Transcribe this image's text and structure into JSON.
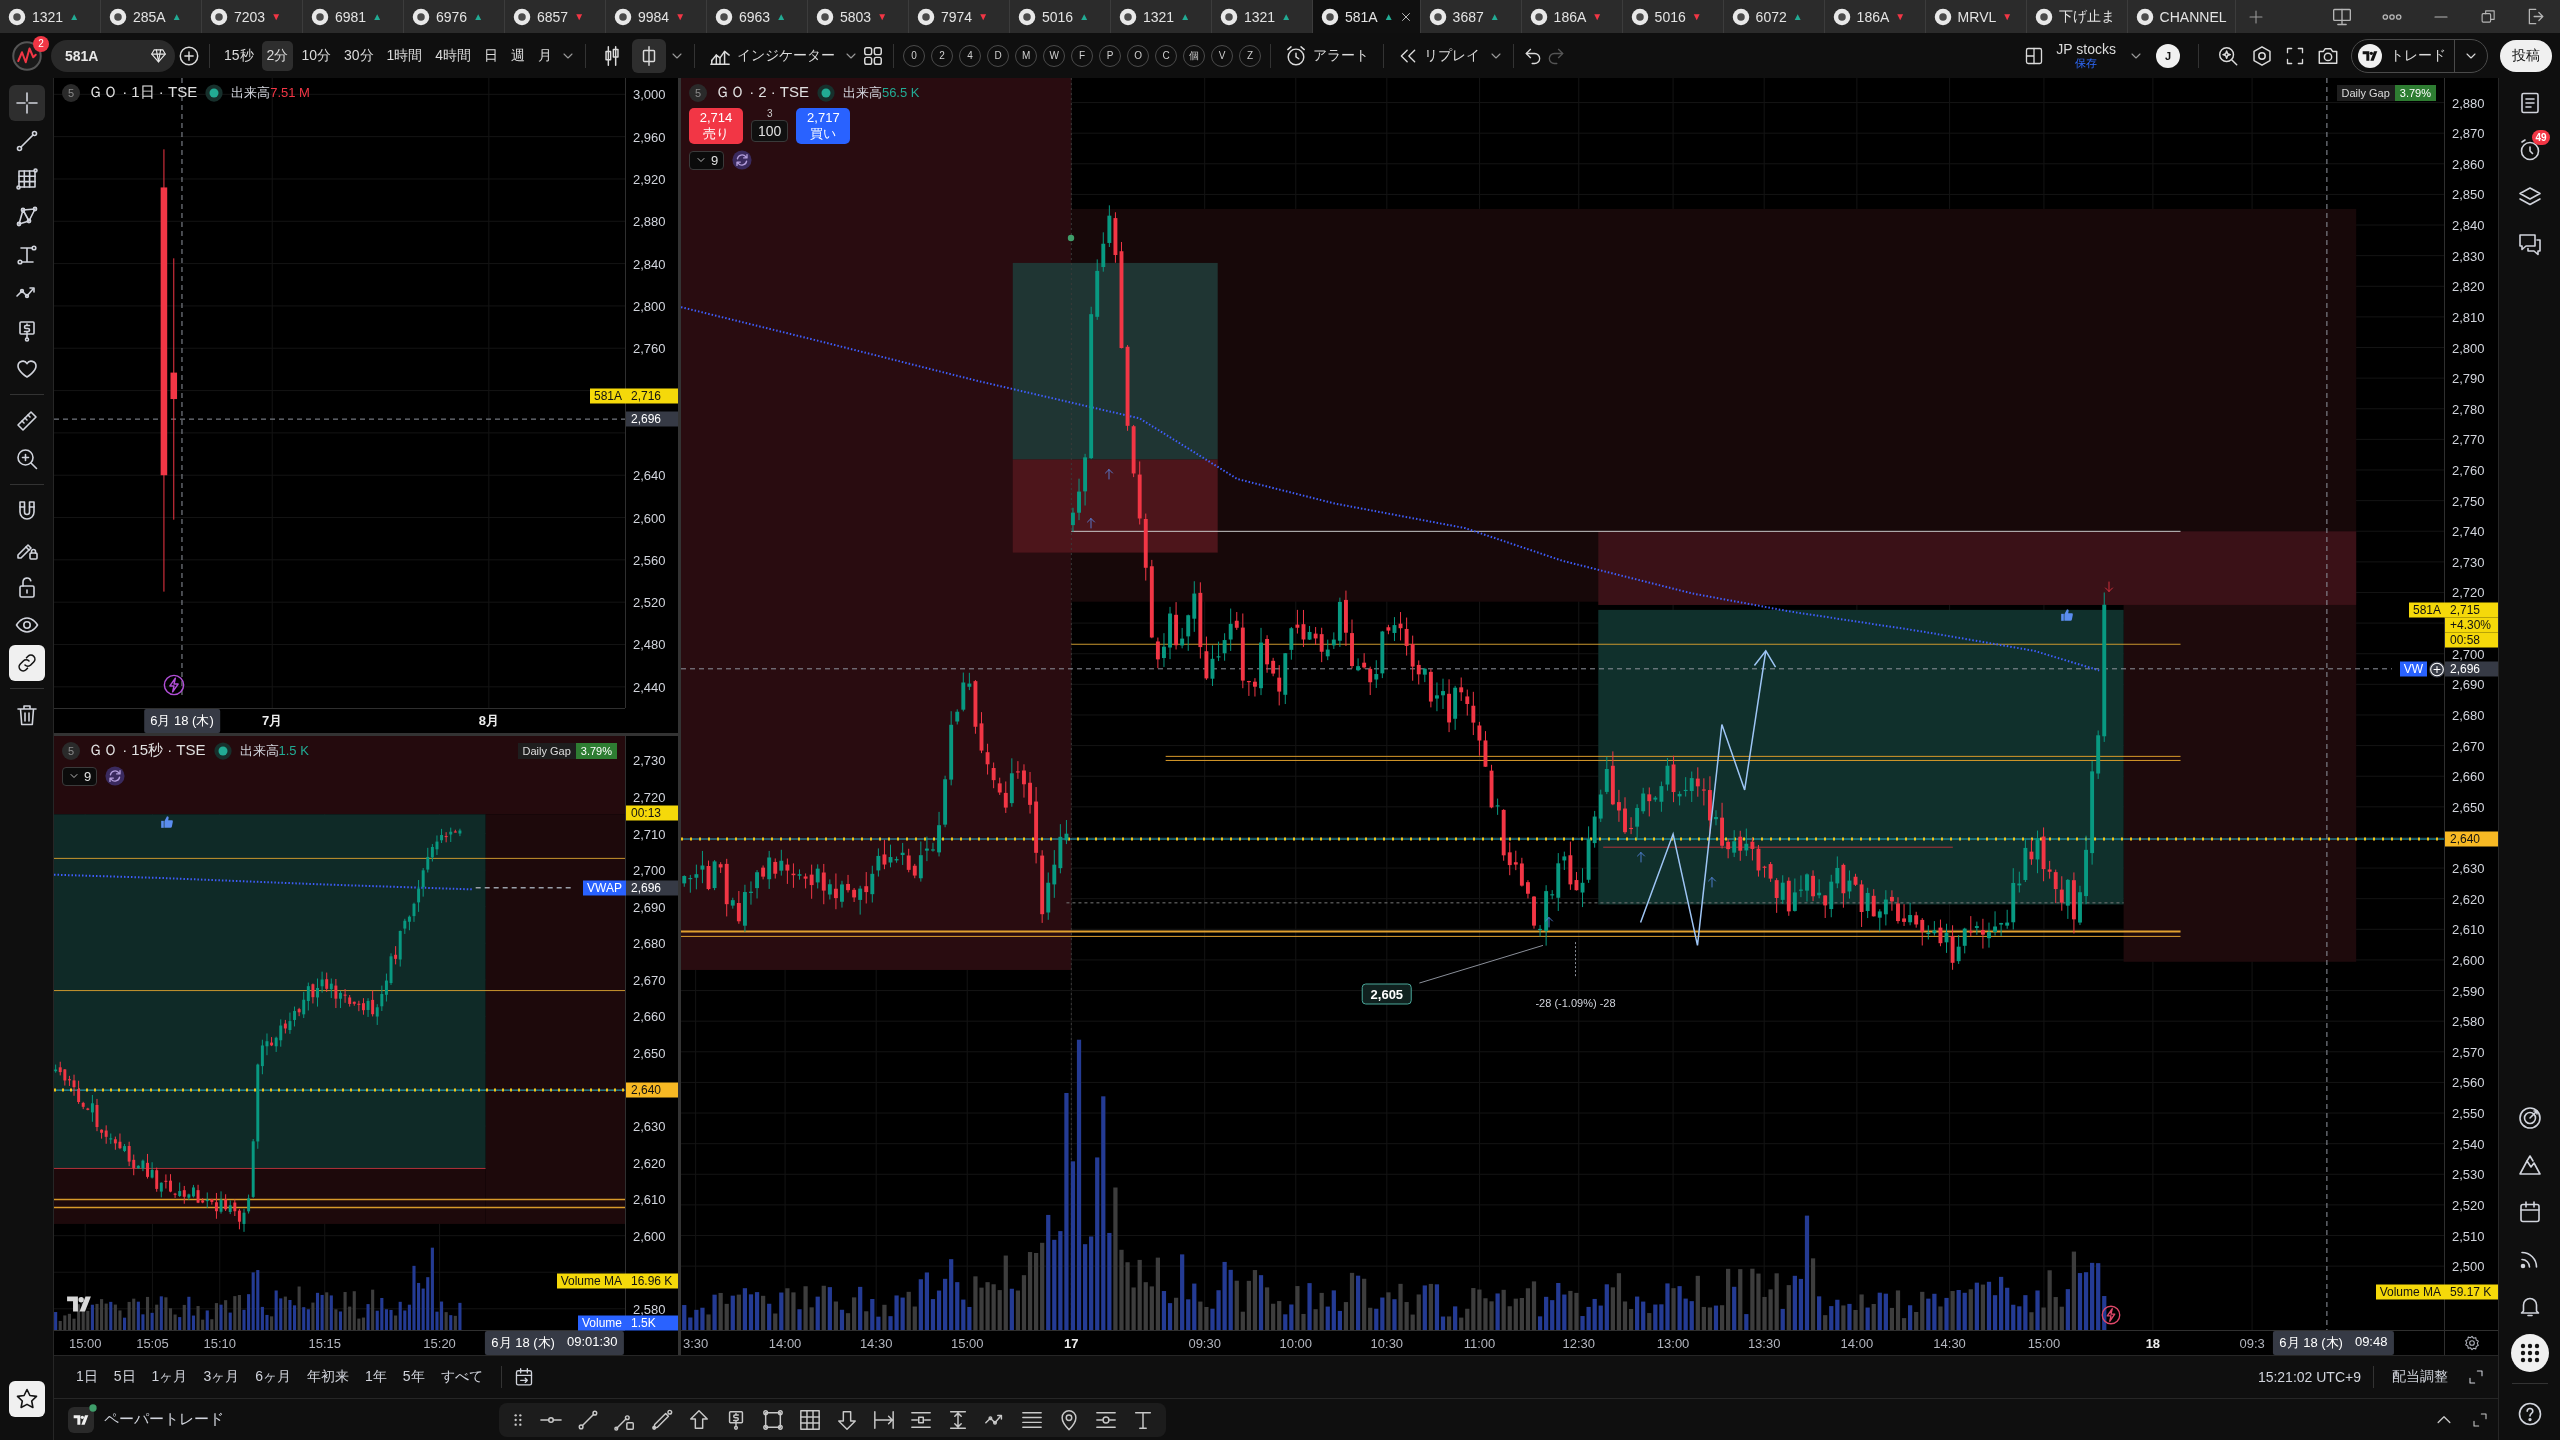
{
  "tabs": [
    {
      "symbol": "1321",
      "arrow": "▲",
      "color": "#22ab94",
      "selected": false
    },
    {
      "symbol": "285A",
      "arrow": "▲",
      "color": "#22ab94",
      "selected": false
    },
    {
      "symbol": "7203",
      "arrow": "▼",
      "color": "#f23645",
      "selected": false
    },
    {
      "symbol": "6981",
      "arrow": "▲",
      "color": "#22ab94",
      "selected": false
    },
    {
      "symbol": "6976",
      "arrow": "▲",
      "color": "#22ab94",
      "selected": false
    },
    {
      "symbol": "6857",
      "arrow": "▼",
      "color": "#f23645",
      "selected": false
    },
    {
      "symbol": "9984",
      "arrow": "▼",
      "color": "#f23645",
      "selected": false
    },
    {
      "symbol": "6963",
      "arrow": "▲",
      "color": "#22ab94",
      "selected": false
    },
    {
      "symbol": "5803",
      "arrow": "▼",
      "color": "#f23645",
      "selected": false
    },
    {
      "symbol": "7974",
      "arrow": "▼",
      "color": "#f23645",
      "selected": false
    },
    {
      "symbol": "5016",
      "arrow": "▲",
      "color": "#22ab94",
      "selected": false
    },
    {
      "symbol": "1321",
      "arrow": "▲",
      "color": "#22ab94",
      "selected": false
    },
    {
      "symbol": "1321",
      "arrow": "▲",
      "color": "#22ab94",
      "selected": false
    },
    {
      "symbol": "581A",
      "arrow": "▲",
      "color": "#22ab94",
      "selected": true
    },
    {
      "symbol": "3687",
      "arrow": "▲",
      "color": "#22ab94",
      "selected": false
    },
    {
      "symbol": "186A",
      "arrow": "▼",
      "color": "#f23645",
      "selected": false
    },
    {
      "symbol": "5016",
      "arrow": "▼",
      "color": "#f23645",
      "selected": false
    },
    {
      "symbol": "6072",
      "arrow": "▲",
      "color": "#22ab94",
      "selected": false
    },
    {
      "symbol": "186A",
      "arrow": "▼",
      "color": "#f23645",
      "selected": false
    },
    {
      "symbol": "MRVL",
      "arrow": "▼",
      "color": "#f23645",
      "selected": false
    },
    {
      "symbol": "下げ止ま",
      "selected": false
    },
    {
      "symbol": "CHANNEL",
      "selected": false
    }
  ],
  "toolbar": {
    "notification_badge": "2",
    "symbol_search": {
      "value": "581A"
    },
    "intervals": [
      {
        "label": "15秒",
        "selected": false
      },
      {
        "label": "2分",
        "selected": true
      },
      {
        "label": "10分",
        "selected": false
      },
      {
        "label": "30分",
        "selected": false
      },
      {
        "label": "1時間",
        "selected": false
      },
      {
        "label": "4時間",
        "selected": false
      },
      {
        "label": "日",
        "selected": false
      },
      {
        "label": "週",
        "selected": false
      },
      {
        "label": "月",
        "selected": false
      }
    ],
    "chart_types": [
      {
        "selected": false
      },
      {
        "selected": true
      }
    ],
    "indicators_label": "インジケーター",
    "quick_buttons": [
      "0",
      "2",
      "4",
      "D",
      "M",
      "W",
      "F",
      "P",
      "O",
      "C",
      "個",
      "V",
      "Z"
    ],
    "alert_label": "アラート",
    "replay_label": "リプレイ",
    "layout": {
      "name": "JP stocks",
      "status": "保存"
    },
    "account_initial": "J",
    "trade_label": "トレード",
    "publish_label": "投稿"
  },
  "left_toolbar": {
    "tools": [
      {
        "selected": true
      },
      {
        "selected": false
      },
      {
        "selected": false
      },
      {
        "selected": false
      },
      {
        "selected": false
      },
      {
        "selected": false
      },
      {
        "selected": false
      },
      {
        "selected": false
      },
      {
        "selected": false
      },
      {
        "selected": false
      }
    ],
    "toggles": [
      {
        "on": false
      },
      {
        "on": false
      },
      {
        "on": false
      },
      {
        "on": false
      },
      {
        "on": true
      }
    ]
  },
  "charts": [
    {
      "kind": "daily",
      "header": {
        "badge": "5",
        "title": "ＧＯ · 1日 · TSE",
        "volume_label": "出来高",
        "volume": "7.51 M",
        "color": "#f23645"
      },
      "price_ticks": [
        "3,000",
        "2,960",
        "2,920",
        "2,880",
        "2,840",
        "2,800",
        "2,760",
        "2,640",
        "2,600",
        "2,560",
        "2,520",
        "2,480",
        "2,440"
      ],
      "price_labels": [
        {
          "kind": "last",
          "symbol": "581A",
          "price": "2,716"
        },
        {
          "kind": "crosshair",
          "price": "2,696"
        }
      ],
      "time_labels": [
        {
          "text": "7月",
          "kind": "month"
        },
        {
          "text": "8月",
          "kind": "month"
        }
      ],
      "cursor": {
        "date": "6月 18 (木)"
      }
    },
    {
      "kind": "tick",
      "header": {
        "badge": "5",
        "title": "ＧＯ · 15秒 · TSE",
        "volume_label": "出来高",
        "volume": "1.5 K",
        "color": "#22ab94"
      },
      "legend_count": "9",
      "daily_gap": {
        "label": "Daily Gap",
        "value": "3.79%"
      },
      "price_ticks": [
        "2,730",
        "2,720",
        "2,710",
        "2,700",
        "2,690",
        "2,680",
        "2,670",
        "2,660",
        "2,650",
        "2,630",
        "2,620",
        "2,610",
        "2,600",
        "2,580"
      ],
      "price_labels": [
        {
          "kind": "countdown",
          "text": "00:13"
        },
        {
          "kind": "crosshair",
          "tag": "VWAP",
          "price": "2,696"
        },
        {
          "kind": "level",
          "price": "2,640"
        },
        {
          "kind": "volume_ma",
          "tag": "Volume MA",
          "value": "16.96 K"
        },
        {
          "kind": "volume",
          "tag": "Volume",
          "value": "1.5K"
        }
      ],
      "time_labels": [
        {
          "text": "15:00",
          "kind": "time"
        },
        {
          "text": "15:05",
          "kind": "time"
        },
        {
          "text": "15:10",
          "kind": "time"
        },
        {
          "text": "15:15",
          "kind": "time"
        },
        {
          "text": "15:20",
          "kind": "time"
        }
      ],
      "cursor": {
        "date": "6月 18 (木)",
        "time": "09:01:30"
      }
    },
    {
      "kind": "intraday",
      "header": {
        "badge": "5",
        "title": "ＧＯ · 2 · TSE",
        "volume_label": "出来高",
        "volume": "56.5 K",
        "color": "#22ab94"
      },
      "trade": {
        "sell_price": "2,714",
        "sell_label": "売り",
        "quantity_step": "3",
        "quantity": "100",
        "buy_price": "2,717",
        "buy_label": "買い"
      },
      "legend_count": "9",
      "daily_gap": {
        "label": "Daily Gap",
        "value": "3.79%"
      },
      "price_ticks": [
        "2,880",
        "2,870",
        "2,860",
        "2,850",
        "2,840",
        "2,830",
        "2,820",
        "2,810",
        "2,800",
        "2,790",
        "2,780",
        "2,770",
        "2,760",
        "2,750",
        "2,740",
        "2,730",
        "2,720",
        "2,700",
        "2,690",
        "2,680",
        "2,670",
        "2,660",
        "2,650",
        "2,630",
        "2,620",
        "2,610",
        "2,600",
        "2,590",
        "2,580",
        "2,570",
        "2,560",
        "2,550",
        "2,540",
        "2,530",
        "2,520",
        "2,510",
        "2,500"
      ],
      "price_labels": [
        {
          "kind": "last",
          "symbol": "581A",
          "price": "2,715",
          "change": "+4.30%",
          "countdown": "00:58"
        },
        {
          "kind": "crosshair",
          "tag": "VW",
          "price": "2,696"
        },
        {
          "kind": "level",
          "price": "2,640"
        },
        {
          "kind": "volume_ma",
          "tag": "Volume MA",
          "value": "59.17 K"
        }
      ],
      "annotations": [
        {
          "kind": "price_box",
          "text": "2,605"
        },
        {
          "kind": "measure",
          "text": "-28 (-1.09%) -28"
        }
      ],
      "time_labels": [
        {
          "text": "3:30",
          "kind": "time"
        },
        {
          "text": "14:00",
          "kind": "time"
        },
        {
          "text": "14:30",
          "kind": "time"
        },
        {
          "text": "15:00",
          "kind": "time"
        },
        {
          "text": "17",
          "kind": "day"
        },
        {
          "text": "09:30",
          "kind": "time"
        },
        {
          "text": "10:00",
          "kind": "time"
        },
        {
          "text": "10:30",
          "kind": "time"
        },
        {
          "text": "11:00",
          "kind": "time"
        },
        {
          "text": "12:30",
          "kind": "time"
        },
        {
          "text": "13:00",
          "kind": "time"
        },
        {
          "text": "13:30",
          "kind": "time"
        },
        {
          "text": "14:00",
          "kind": "time"
        },
        {
          "text": "14:30",
          "kind": "time"
        },
        {
          "text": "15:00",
          "kind": "time"
        },
        {
          "text": "18",
          "kind": "day"
        },
        {
          "text": "09:3",
          "kind": "time"
        }
      ],
      "cursor": {
        "date": "6月 18 (木)",
        "time": "09:48"
      }
    }
  ],
  "right_sidebar": {
    "items": [
      {
        "selected": false
      },
      {
        "selected": false,
        "badge": "49"
      },
      {
        "selected": false
      },
      {
        "selected": false
      },
      {
        "selected": false
      },
      {
        "selected": false
      },
      {
        "selected": false
      },
      {
        "selected": false
      },
      {
        "selected": false
      },
      {
        "selected": true
      },
      {
        "selected": false
      }
    ]
  },
  "range_bar": {
    "ranges": [
      "1日",
      "5日",
      "1ヶ月",
      "3ヶ月",
      "6ヶ月",
      "年初来",
      "1年",
      "5年",
      "すべて"
    ],
    "clock": "15:21:02 UTC+9",
    "adjustment": "配当調整"
  },
  "bottom_bar": {
    "panel_label": "ペーパートレード"
  }
}
